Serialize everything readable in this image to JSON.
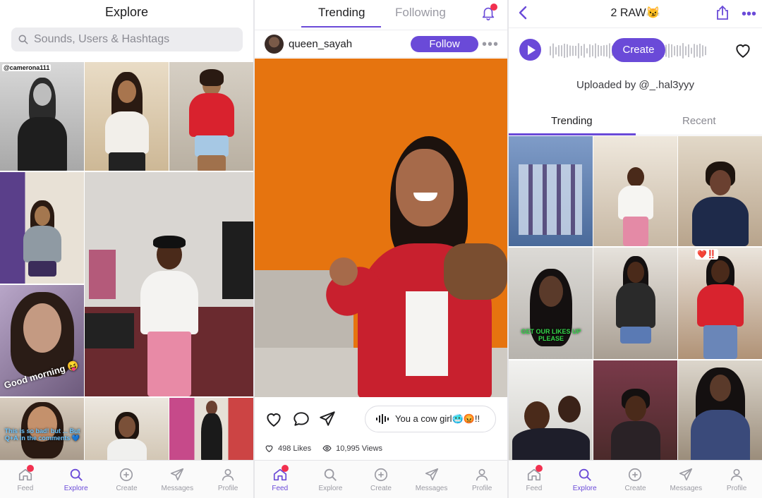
{
  "explore": {
    "title": "Explore",
    "search_placeholder": "Sounds, Users & Hashtags",
    "tile_labels": {
      "tag_user": "@camerona111",
      "good_morning": "Good morning 😝",
      "qa_text": "This is so bad! but ... But Q+A in the comments 💙"
    }
  },
  "feed": {
    "tabs": [
      "Trending",
      "Following"
    ],
    "active_tab": "Trending",
    "username": "queen_sayah",
    "follow_label": "Follow",
    "sound_text": "You a cow girl🥶😡!!",
    "likes": "498 Likes",
    "views": "10,995 Views"
  },
  "sound_page": {
    "title": "2 RAW😼",
    "create_label": "Create",
    "uploaded_by": "Uploaded by @_.hal3yyy",
    "tabs": [
      "Trending",
      "Recent"
    ],
    "active_tab": "Trending",
    "tile_labels": {
      "likes_caption": "GET OUR LIKES UP PLEASE",
      "hearts_tag": "❤️‼️"
    }
  },
  "nav": {
    "panel1": [
      {
        "label": "Feed",
        "icon": "home-icon",
        "active": false,
        "badge": true
      },
      {
        "label": "Explore",
        "icon": "search-icon",
        "active": true,
        "badge": false
      },
      {
        "label": "Create",
        "icon": "plus-circle-icon",
        "active": false,
        "badge": false
      },
      {
        "label": "Messages",
        "icon": "send-icon",
        "active": false,
        "badge": false
      },
      {
        "label": "Profile",
        "icon": "person-icon",
        "active": false,
        "badge": false
      }
    ],
    "panel2": [
      {
        "label": "Feed",
        "icon": "home-icon",
        "active": true,
        "badge": true
      },
      {
        "label": "Explore",
        "icon": "search-icon",
        "active": false,
        "badge": false
      },
      {
        "label": "Create",
        "icon": "plus-circle-icon",
        "active": false,
        "badge": false
      },
      {
        "label": "Messages",
        "icon": "send-icon",
        "active": false,
        "badge": false
      },
      {
        "label": "Profile",
        "icon": "person-icon",
        "active": false,
        "badge": false
      }
    ],
    "panel3": [
      {
        "label": "Feed",
        "icon": "home-icon",
        "active": false,
        "badge": true
      },
      {
        "label": "Explore",
        "icon": "search-icon",
        "active": true,
        "badge": false
      },
      {
        "label": "Create",
        "icon": "plus-circle-icon",
        "active": false,
        "badge": false
      },
      {
        "label": "Messages",
        "icon": "send-icon",
        "active": false,
        "badge": false
      },
      {
        "label": "Profile",
        "icon": "person-icon",
        "active": false,
        "badge": false
      }
    ]
  },
  "colors": {
    "accent": "#6a4ad8",
    "badge": "#f2304f",
    "video_wall": "#e6740f",
    "jacket": "#c8202e"
  }
}
